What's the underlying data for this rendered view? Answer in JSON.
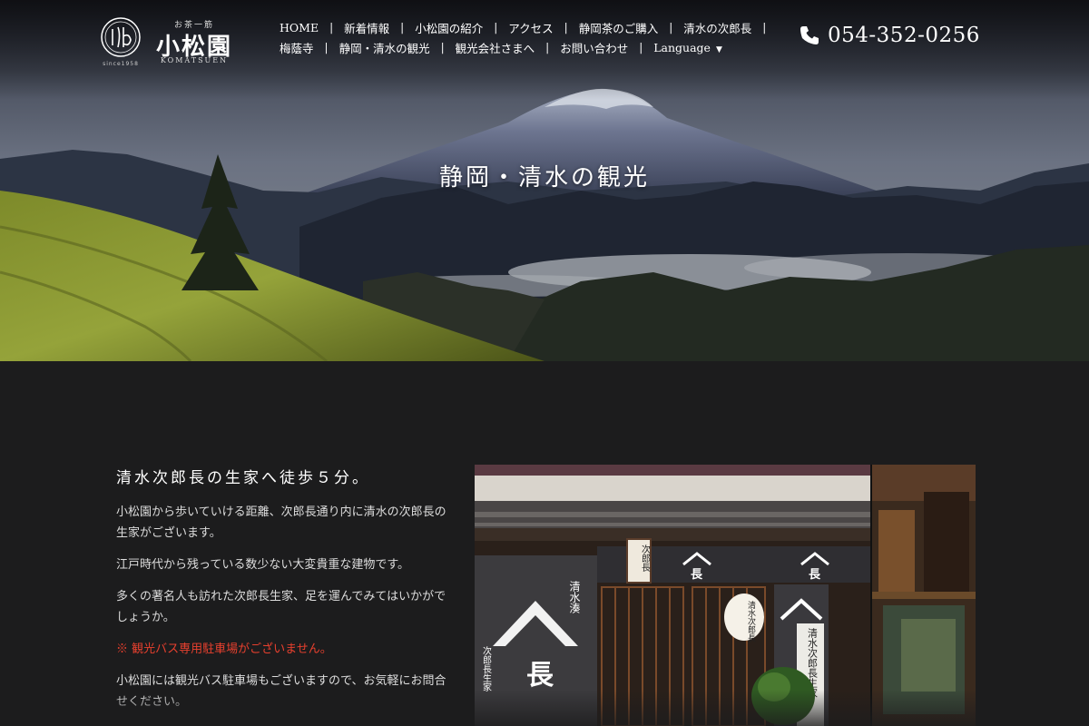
{
  "brand": {
    "tagline": "お茶一筋",
    "name": "小松園",
    "roman": "KOMATSUEN",
    "since": "since1958"
  },
  "nav": {
    "row1": [
      "HOME",
      "新着情報",
      "小松園の紹介",
      "アクセス",
      "静岡茶のご購入",
      "清水の次郎長"
    ],
    "row2": [
      "梅蔭寺",
      "静岡・清水の観光",
      "観光会社さまへ",
      "お問い合わせ",
      "Language"
    ]
  },
  "phone": {
    "icon": "phone-icon",
    "number": "054-352-0256"
  },
  "hero": {
    "title": "静岡・清水の観光"
  },
  "content": {
    "heading": "清水次郎長の生家へ徒歩５分。",
    "paragraphs": [
      "小松園から歩いていける距離、次郎長通り内に清水の次郎長の生家がございます。",
      "江戸時代から残っている数少ない大変貴重な建物です。",
      "多くの著名人も訪れた次郎長生家、足を運んでみてはいかがでしょうか。"
    ],
    "notice": "※ 観光バス専用駐車場がございません。",
    "closing": "小松園には観光バス駐車場もございますので、お気軽にお問合せください。"
  },
  "photo": {
    "main_noren_text": "清水湊",
    "main_noren_subtext": "次郎長生家",
    "crest": "長",
    "sign": "次郎長",
    "lantern": "清水次郎長",
    "side_noren": "清水次郎長生家"
  },
  "colors": {
    "background": "#1c1c1d",
    "notice": "#e8402e",
    "text": "#dddddd"
  }
}
